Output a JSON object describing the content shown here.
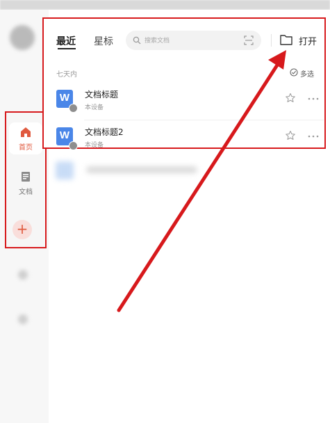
{
  "nav": {
    "items": [
      {
        "label": "首页",
        "icon": "home-icon"
      },
      {
        "label": "文档",
        "icon": "document-icon"
      }
    ],
    "add_icon": "plus-icon"
  },
  "recent_panel": {
    "tabs": [
      {
        "label": "最近",
        "active": true
      },
      {
        "label": "星标",
        "active": false
      }
    ],
    "search": {
      "placeholder": "搜索文档",
      "icon": "search-icon",
      "scan_icon": "scan-icon"
    },
    "open_button": {
      "label": "打开",
      "icon": "folder-icon"
    },
    "section_label": "七天内",
    "multi_select_label": "多选",
    "documents": [
      {
        "title": "文档标题",
        "location": "本设备",
        "icon": "word-doc-icon"
      },
      {
        "title": "文档标题2",
        "location": "本设备",
        "icon": "word-doc-icon"
      }
    ]
  },
  "colors": {
    "highlight_red": "#d7191c",
    "accent_orange": "#e05a3f",
    "word_blue": "#4a86e8"
  }
}
